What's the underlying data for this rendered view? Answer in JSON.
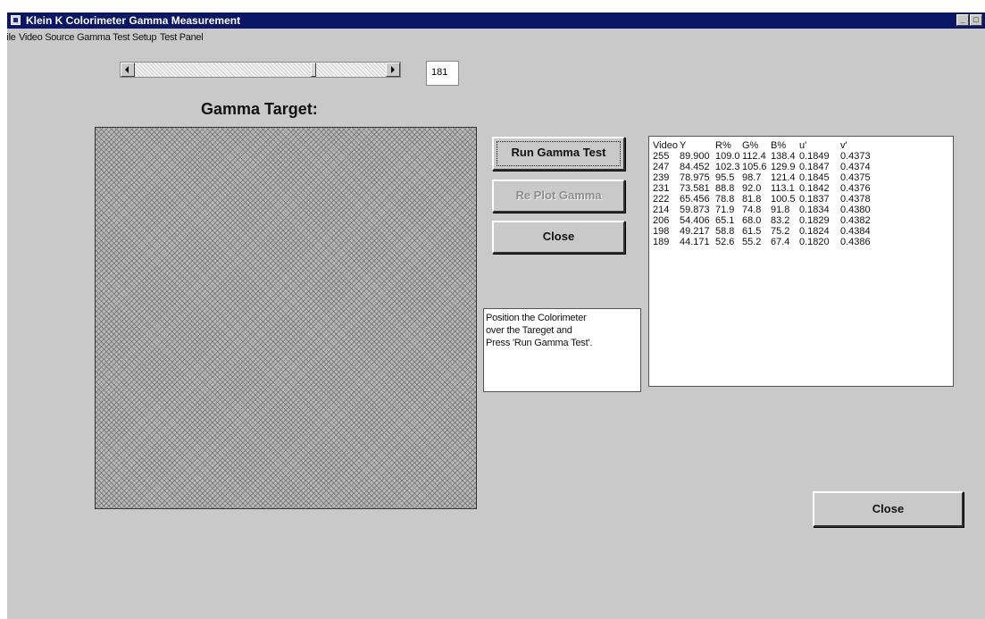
{
  "window": {
    "title": "Klein K Colorimeter Gamma Measurement"
  },
  "menu": [
    "File",
    "Video Source",
    "Gamma Test Setup",
    "Test Panel"
  ],
  "slider": {
    "value": "181",
    "position_fraction": 0.71
  },
  "target": {
    "label": "Gamma Target:"
  },
  "buttons": {
    "run": "Run Gamma Test",
    "replot": "Re Plot Gamma",
    "close": "Close",
    "close_bottom": "Close"
  },
  "message": [
    "Position the Colorimeter",
    "over the Tareget and",
    "Press 'Run Gamma Test'."
  ],
  "results": {
    "headers": [
      "Video",
      "Y",
      "R%",
      "G%",
      "B%",
      "u'",
      "v'"
    ],
    "rows": [
      [
        "255",
        "89.900",
        "109.0",
        "112.4",
        "138.4",
        "0.1849",
        "0.4373"
      ],
      [
        "247",
        "84.452",
        "102.3",
        "105.6",
        "129.9",
        "0.1847",
        "0.4374"
      ],
      [
        "239",
        "78.975",
        "95.5",
        "98.7",
        "121.4",
        "0.1845",
        "0.4375"
      ],
      [
        "231",
        "73.581",
        "88.8",
        "92.0",
        "113.1",
        "0.1842",
        "0.4376"
      ],
      [
        "222",
        "65.456",
        "78.8",
        "81.8",
        "100.5",
        "0.1837",
        "0.4378"
      ],
      [
        "214",
        "59.873",
        "71.9",
        "74.8",
        "91.8",
        "0.1834",
        "0.4380"
      ],
      [
        "206",
        "54.406",
        "65.1",
        "68.0",
        "83.2",
        "0.1829",
        "0.4382"
      ],
      [
        "198",
        "49.217",
        "58.8",
        "61.5",
        "75.2",
        "0.1824",
        "0.4384"
      ],
      [
        "189",
        "44.171",
        "52.6",
        "55.2",
        "67.4",
        "0.1820",
        "0.4386"
      ]
    ]
  },
  "colors": {
    "titlebar": "#0a1766",
    "window_bg": "#c9c9c9",
    "disabled_text": "#8e8e8e"
  }
}
